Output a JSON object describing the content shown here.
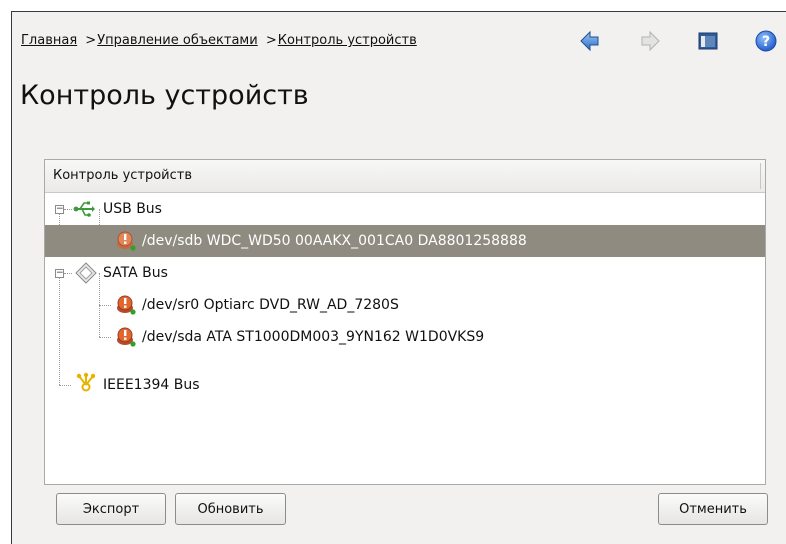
{
  "breadcrumb": {
    "home": "Главная",
    "objects": "Управление объектами",
    "current": "Контроль устройств",
    "separator": ">"
  },
  "toolbar": {
    "back": "arrow-left-icon",
    "forward": "arrow-right-icon",
    "window": "window-icon",
    "help": "help-icon"
  },
  "page": {
    "title": "Контроль устройств"
  },
  "tree": {
    "header": "Контроль устройств",
    "usb": {
      "label": "USB Bus",
      "devices": [
        "/dev/sdb WDC_WD50 00AAKX_001CA0 DA8801258888"
      ]
    },
    "sata": {
      "label": "SATA Bus",
      "devices": [
        "/dev/sr0 Optiarc DVD_RW_AD_7280S",
        "/dev/sda ATA ST1000DM003_9YN162 W1D0VKS9"
      ]
    },
    "ieee": {
      "label": "IEEE1394 Bus"
    }
  },
  "buttons": {
    "export": "Экспорт",
    "refresh": "Обновить",
    "cancel": "Отменить"
  },
  "colors": {
    "selection": "#8f8b80",
    "arrow_blue": "#3a78c8",
    "help_blue": "#2a6ad8"
  }
}
